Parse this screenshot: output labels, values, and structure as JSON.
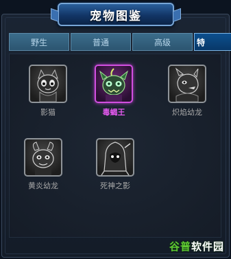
{
  "window": {
    "title": "宠物图鉴"
  },
  "tabs": [
    {
      "label": "野生",
      "active": false
    },
    {
      "label": "普通",
      "active": false
    },
    {
      "label": "高级",
      "active": false
    },
    {
      "label": "特",
      "active": true
    }
  ],
  "pets": [
    {
      "name": "影猫",
      "selected": false,
      "portrait": "shadow-cat-portrait"
    },
    {
      "name": "毒蝎王",
      "selected": true,
      "portrait": "poison-scorpion-king-portrait"
    },
    {
      "name": "炽焰幼龙",
      "selected": false,
      "portrait": "blazing-young-dragon-portrait"
    },
    {
      "name": "黄炎幼龙",
      "selected": false,
      "portrait": "yellow-flame-young-dragon-portrait"
    },
    {
      "name": "死神之影",
      "selected": false,
      "portrait": "death-shadow-portrait"
    }
  ],
  "watermark": {
    "part_a": "谷普",
    "part_b": "软件园"
  },
  "colors": {
    "selected_border": "#d24fe0",
    "selected_name": "#e55af0",
    "tab_active": "#0c4f8e"
  }
}
